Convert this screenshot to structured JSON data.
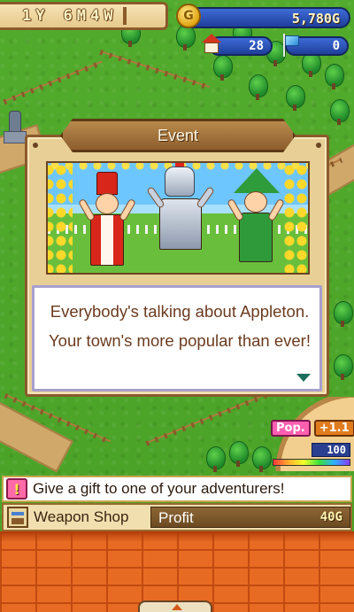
{
  "hud": {
    "year_value": "1",
    "year_unit": "Y",
    "month_value": "6",
    "month_unit": "M",
    "week_value": "4",
    "week_unit": "W",
    "coin_symbol": "G",
    "money": "5,780G",
    "houses": "28",
    "flags": "0"
  },
  "event": {
    "title": "Event",
    "message": "Everybody's talking about Appleton. Your town's more popular than ever!",
    "scene_icon": "celebrating-adventurers-image"
  },
  "popularity": {
    "label": "Pop.",
    "change": "+1.1",
    "value": "100"
  },
  "notice": {
    "icon": "!",
    "text": "Give a gift to one of your adventurers!"
  },
  "shop": {
    "name": "Weapon Shop",
    "profit_label": "Profit",
    "profit_value": "40G"
  },
  "colors": {
    "grass": "#4fa82a",
    "accent_blue": "#1f3f9a",
    "panel_wood": "#8b5a2b",
    "text_brown": "#6b3b1f",
    "bricks": "#e76b22"
  }
}
